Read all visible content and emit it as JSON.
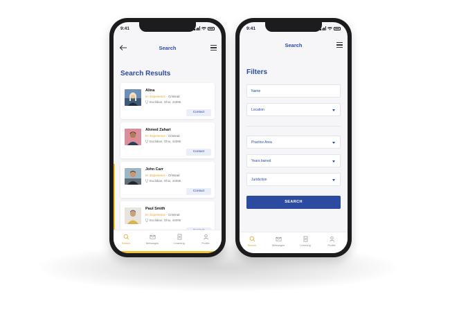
{
  "left_phone": {
    "status_time": "9:41",
    "nav_title": "Search",
    "heading": "Search Results",
    "results": [
      {
        "name": "Alina",
        "experience": "5+ Experience",
        "separator": "·",
        "practice": "Criminal",
        "location": "Euclidian, Ohio, 44095",
        "contact_label": "Contact"
      },
      {
        "name": "Ahmed Zahari",
        "experience": "5+ Experience",
        "separator": "·",
        "practice": "Criminal",
        "location": "Euclidian, Ohio, 44095",
        "contact_label": "Contact"
      },
      {
        "name": "John Carr",
        "experience": "5+ Experience",
        "separator": "·",
        "practice": "Criminal",
        "location": "Euclidian, Ohio, 44095",
        "contact_label": "Contact"
      },
      {
        "name": "Paul Smith",
        "experience": "5+ Experience",
        "separator": "·",
        "practice": "Criminal",
        "location": "Euclidian, Ohio, 44095",
        "contact_label": "Contact"
      }
    ],
    "tabs": [
      {
        "label": "Search",
        "icon": "search-icon"
      },
      {
        "label": "Messages",
        "icon": "mail-icon"
      },
      {
        "label": "Learning",
        "icon": "document-icon"
      },
      {
        "label": "Profile",
        "icon": "user-icon"
      }
    ],
    "active_tab": "Search"
  },
  "right_phone": {
    "status_time": "9:41",
    "nav_title": "Search",
    "heading": "Filters",
    "name_field": {
      "placeholder": "Name"
    },
    "location_select": {
      "label": "Location"
    },
    "practice_area_select": {
      "label": "Practice Area"
    },
    "years_barred_select": {
      "label": "Years barred"
    },
    "jurisdiction_select": {
      "label": "Juridiction"
    },
    "search_button": "SEARCH",
    "tabs": [
      {
        "label": "Search",
        "icon": "search-icon"
      },
      {
        "label": "Messages",
        "icon": "mail-icon"
      },
      {
        "label": "Learning",
        "icon": "document-icon"
      },
      {
        "label": "Profile",
        "icon": "user-icon"
      }
    ],
    "active_tab": "Search"
  },
  "colors": {
    "primary": "#2b4aa0",
    "accent": "#e5a323",
    "highlight": "#f2c62f",
    "background": "#f6f6f8"
  }
}
